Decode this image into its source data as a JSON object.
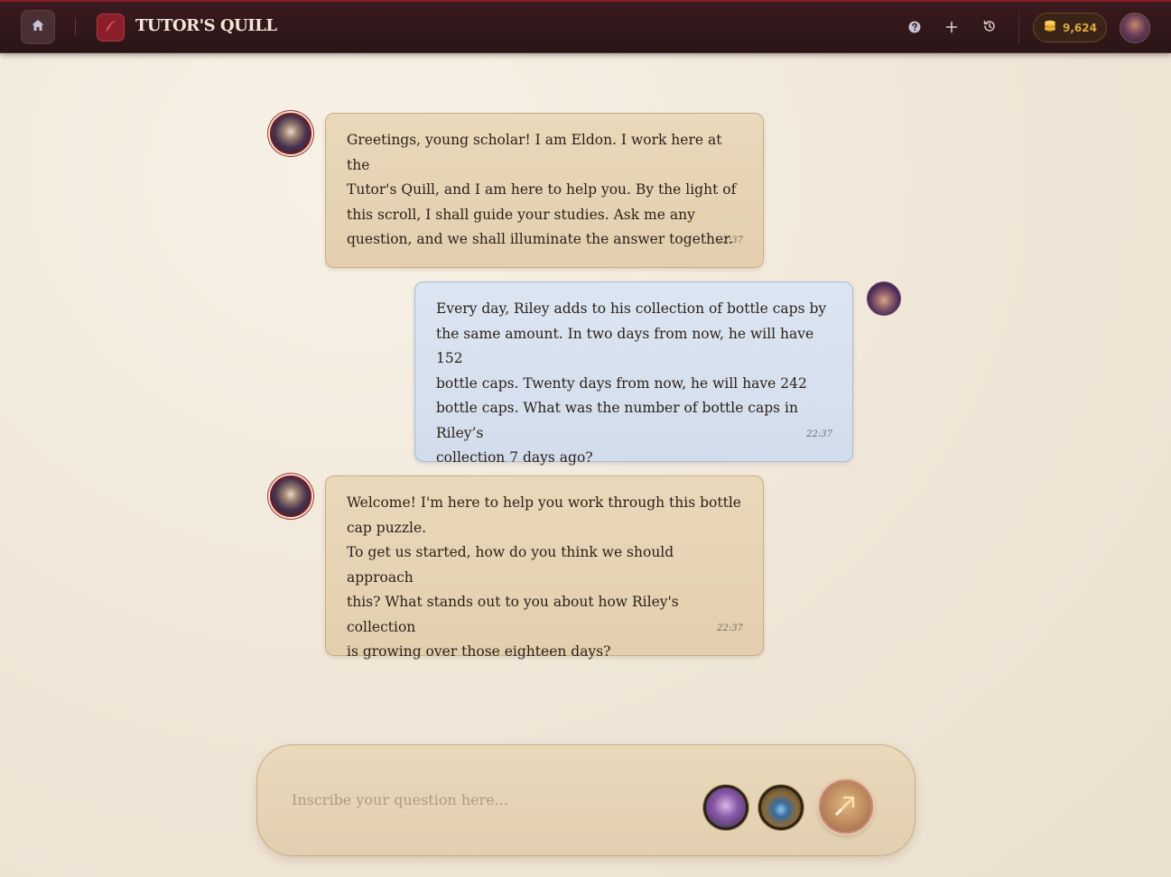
{
  "header": {
    "brand": "TUTOR'S QUILL",
    "coins": "9,624",
    "icons": [
      "home-icon",
      "quill-icon",
      "help-icon",
      "plus-icon",
      "history-icon",
      "coins-icon"
    ]
  },
  "messages": [
    {
      "role": "tutor",
      "lines": [
        "Greetings, young scholar! I am Eldon. I work here at the",
        "Tutor's Quill, and I am here to help you. By the light of",
        "this scroll, I shall guide your studies. Ask me any",
        "question, and we shall illuminate the answer together."
      ],
      "time": "22:37"
    },
    {
      "role": "user",
      "lines": [
        "Every day, Riley adds to his collection of bottle caps by",
        "the same amount. In two days from now, he will have 152",
        "bottle caps. Twenty days from now, he will have 242",
        "bottle caps. What was the number of bottle caps in Riley’s",
        "collection 7 days ago?"
      ],
      "time": "22:37"
    },
    {
      "role": "tutor",
      "lines": [
        "Welcome! I'm here to help you work through this bottle",
        "cap puzzle.",
        "To get us started, how do you think we should approach",
        "this? What stands out to you about how Riley's collection",
        "is growing over those eighteen days?"
      ],
      "time": "22:37"
    }
  ],
  "composer": {
    "placeholder": "Inscribe your question here..."
  },
  "colors": {
    "header_bg": "#2f1719",
    "accent_red": "#8a1e2a",
    "tutor_bubble": "#e6d3b4",
    "user_bubble": "#d6e0ee",
    "coin_gold": "#e0a83a"
  }
}
